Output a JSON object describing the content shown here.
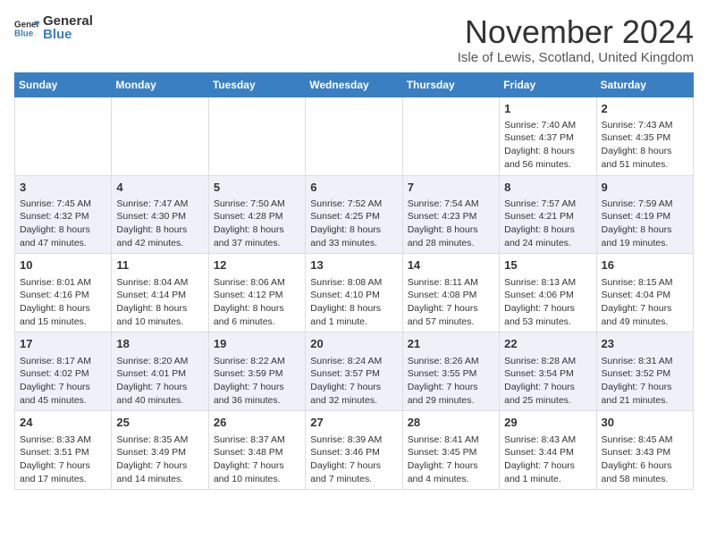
{
  "header": {
    "logo_general": "General",
    "logo_blue": "Blue",
    "month_title": "November 2024",
    "location": "Isle of Lewis, Scotland, United Kingdom"
  },
  "columns": [
    "Sunday",
    "Monday",
    "Tuesday",
    "Wednesday",
    "Thursday",
    "Friday",
    "Saturday"
  ],
  "weeks": [
    [
      {
        "day": "",
        "info": ""
      },
      {
        "day": "",
        "info": ""
      },
      {
        "day": "",
        "info": ""
      },
      {
        "day": "",
        "info": ""
      },
      {
        "day": "",
        "info": ""
      },
      {
        "day": "1",
        "info": "Sunrise: 7:40 AM\nSunset: 4:37 PM\nDaylight: 8 hours and 56 minutes."
      },
      {
        "day": "2",
        "info": "Sunrise: 7:43 AM\nSunset: 4:35 PM\nDaylight: 8 hours and 51 minutes."
      }
    ],
    [
      {
        "day": "3",
        "info": "Sunrise: 7:45 AM\nSunset: 4:32 PM\nDaylight: 8 hours and 47 minutes."
      },
      {
        "day": "4",
        "info": "Sunrise: 7:47 AM\nSunset: 4:30 PM\nDaylight: 8 hours and 42 minutes."
      },
      {
        "day": "5",
        "info": "Sunrise: 7:50 AM\nSunset: 4:28 PM\nDaylight: 8 hours and 37 minutes."
      },
      {
        "day": "6",
        "info": "Sunrise: 7:52 AM\nSunset: 4:25 PM\nDaylight: 8 hours and 33 minutes."
      },
      {
        "day": "7",
        "info": "Sunrise: 7:54 AM\nSunset: 4:23 PM\nDaylight: 8 hours and 28 minutes."
      },
      {
        "day": "8",
        "info": "Sunrise: 7:57 AM\nSunset: 4:21 PM\nDaylight: 8 hours and 24 minutes."
      },
      {
        "day": "9",
        "info": "Sunrise: 7:59 AM\nSunset: 4:19 PM\nDaylight: 8 hours and 19 minutes."
      }
    ],
    [
      {
        "day": "10",
        "info": "Sunrise: 8:01 AM\nSunset: 4:16 PM\nDaylight: 8 hours and 15 minutes."
      },
      {
        "day": "11",
        "info": "Sunrise: 8:04 AM\nSunset: 4:14 PM\nDaylight: 8 hours and 10 minutes."
      },
      {
        "day": "12",
        "info": "Sunrise: 8:06 AM\nSunset: 4:12 PM\nDaylight: 8 hours and 6 minutes."
      },
      {
        "day": "13",
        "info": "Sunrise: 8:08 AM\nSunset: 4:10 PM\nDaylight: 8 hours and 1 minute."
      },
      {
        "day": "14",
        "info": "Sunrise: 8:11 AM\nSunset: 4:08 PM\nDaylight: 7 hours and 57 minutes."
      },
      {
        "day": "15",
        "info": "Sunrise: 8:13 AM\nSunset: 4:06 PM\nDaylight: 7 hours and 53 minutes."
      },
      {
        "day": "16",
        "info": "Sunrise: 8:15 AM\nSunset: 4:04 PM\nDaylight: 7 hours and 49 minutes."
      }
    ],
    [
      {
        "day": "17",
        "info": "Sunrise: 8:17 AM\nSunset: 4:02 PM\nDaylight: 7 hours and 45 minutes."
      },
      {
        "day": "18",
        "info": "Sunrise: 8:20 AM\nSunset: 4:01 PM\nDaylight: 7 hours and 40 minutes."
      },
      {
        "day": "19",
        "info": "Sunrise: 8:22 AM\nSunset: 3:59 PM\nDaylight: 7 hours and 36 minutes."
      },
      {
        "day": "20",
        "info": "Sunrise: 8:24 AM\nSunset: 3:57 PM\nDaylight: 7 hours and 32 minutes."
      },
      {
        "day": "21",
        "info": "Sunrise: 8:26 AM\nSunset: 3:55 PM\nDaylight: 7 hours and 29 minutes."
      },
      {
        "day": "22",
        "info": "Sunrise: 8:28 AM\nSunset: 3:54 PM\nDaylight: 7 hours and 25 minutes."
      },
      {
        "day": "23",
        "info": "Sunrise: 8:31 AM\nSunset: 3:52 PM\nDaylight: 7 hours and 21 minutes."
      }
    ],
    [
      {
        "day": "24",
        "info": "Sunrise: 8:33 AM\nSunset: 3:51 PM\nDaylight: 7 hours and 17 minutes."
      },
      {
        "day": "25",
        "info": "Sunrise: 8:35 AM\nSunset: 3:49 PM\nDaylight: 7 hours and 14 minutes."
      },
      {
        "day": "26",
        "info": "Sunrise: 8:37 AM\nSunset: 3:48 PM\nDaylight: 7 hours and 10 minutes."
      },
      {
        "day": "27",
        "info": "Sunrise: 8:39 AM\nSunset: 3:46 PM\nDaylight: 7 hours and 7 minutes."
      },
      {
        "day": "28",
        "info": "Sunrise: 8:41 AM\nSunset: 3:45 PM\nDaylight: 7 hours and 4 minutes."
      },
      {
        "day": "29",
        "info": "Sunrise: 8:43 AM\nSunset: 3:44 PM\nDaylight: 7 hours and 1 minute."
      },
      {
        "day": "30",
        "info": "Sunrise: 8:45 AM\nSunset: 3:43 PM\nDaylight: 6 hours and 58 minutes."
      }
    ]
  ]
}
